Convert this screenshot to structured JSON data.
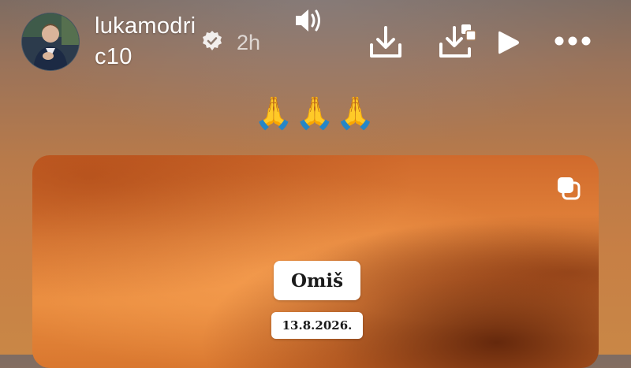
{
  "story": {
    "username": "lukamodric10",
    "verified": true,
    "time_ago": "2h",
    "caption_emoji": "🙏🙏🙏"
  },
  "controls": {
    "sound": "speaker-icon",
    "download": "download-icon",
    "download_all": "download-all-icon",
    "play": "play-icon",
    "more": "more-icon"
  },
  "media": {
    "title": "Omiš",
    "date": "13.8.2026.",
    "carousel_icon": "multiple-items-icon"
  },
  "colors": {
    "fire_orange": "#e4853c",
    "text_white": "#ffffff",
    "label_bg": "#ffffff",
    "label_text": "#1a1a1a"
  }
}
